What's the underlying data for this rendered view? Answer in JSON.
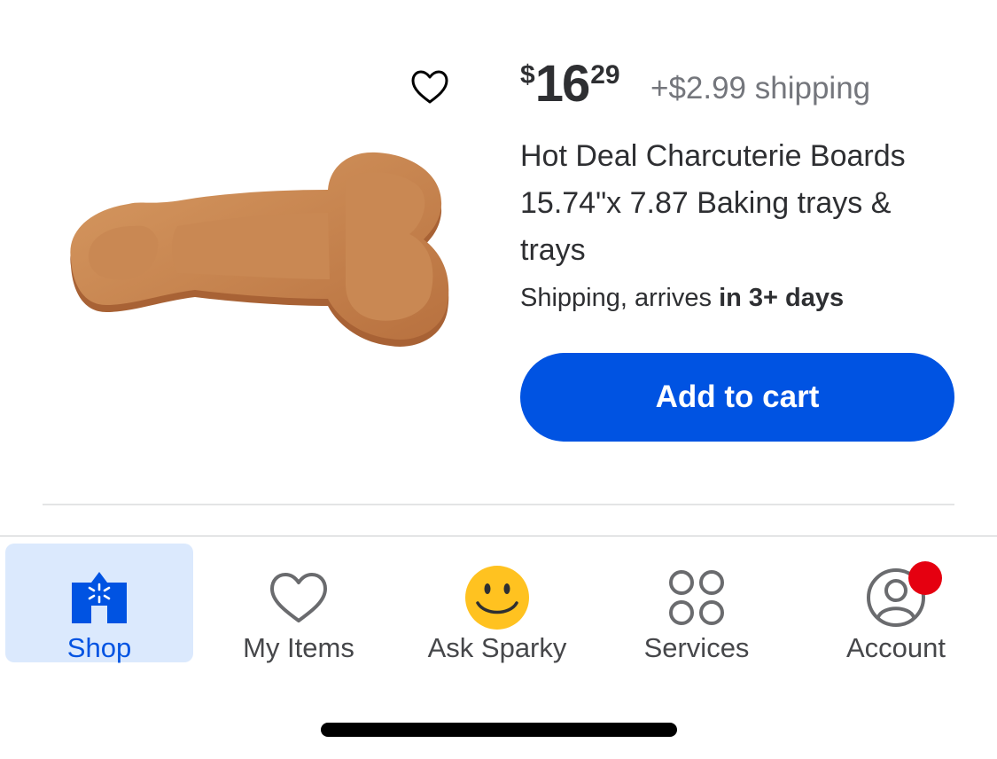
{
  "product": {
    "favorite_icon": "heart-outline-icon",
    "price": {
      "currency": "$",
      "dollars": "16",
      "cents": "29"
    },
    "shipping_fee": "+$2.99 shipping",
    "title": "Hot Deal Charcuterie Boards 15.74\"x 7.87 Baking trays & trays",
    "delivery": {
      "prefix": "Shipping, arrives ",
      "emphasis": "in 3+ days"
    },
    "add_to_cart_label": "Add to cart"
  },
  "tabbar": {
    "tabs": [
      {
        "label": "Shop",
        "icon": "shop-icon",
        "active": true
      },
      {
        "label": "My Items",
        "icon": "heart-outline-icon",
        "active": false
      },
      {
        "label": "Ask Sparky",
        "icon": "smiley-face-icon",
        "active": false
      },
      {
        "label": "Services",
        "icon": "four-circles-icon",
        "active": false
      },
      {
        "label": "Account",
        "icon": "account-icon",
        "active": false,
        "badge": true
      }
    ]
  },
  "colors": {
    "accent": "#0053e2",
    "active_tab_bg": "#dbe9fd",
    "badge": "#e50010",
    "text": "#2e2f32",
    "muted": "#74767c",
    "spark_yellow": "#ffc220"
  }
}
